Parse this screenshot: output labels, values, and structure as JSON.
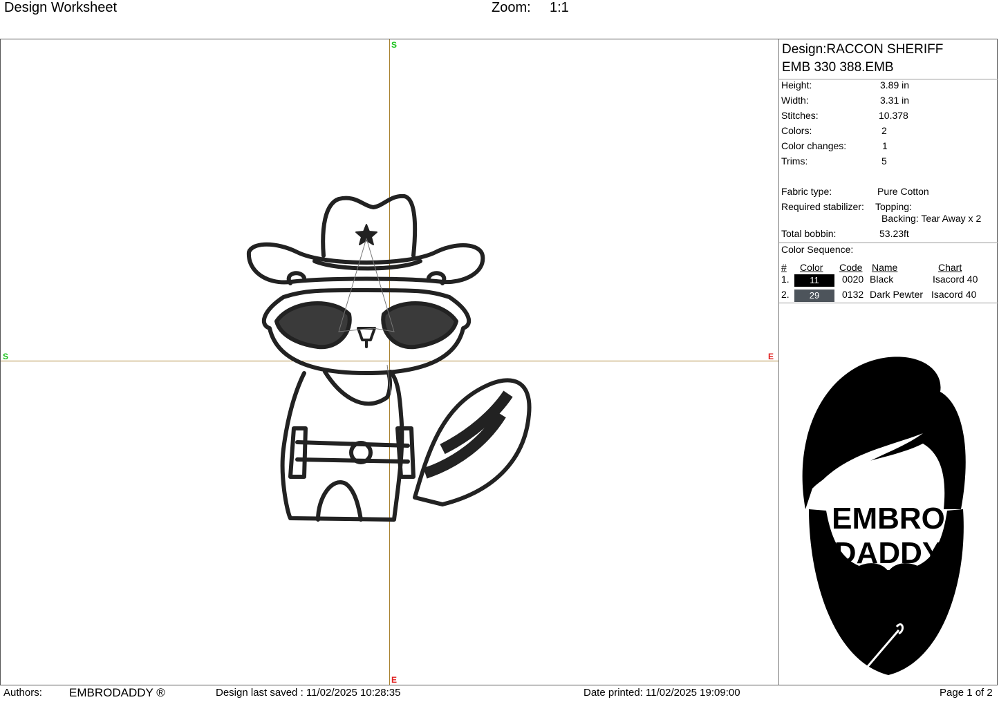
{
  "header": {
    "title": "Design Worksheet",
    "zoom_label": "Zoom:",
    "zoom_value": "1:1"
  },
  "canvas": {
    "axis_markers": {
      "start": "S",
      "end": "E"
    },
    "axis_color": "#a9822f",
    "start_color": "#18c21a",
    "end_color": "#e01d1d"
  },
  "design": {
    "name_line": "Design:RACCON SHERIFF",
    "file_line": "EMB 330 388.EMB"
  },
  "specs": [
    {
      "label": "Height:",
      "value": "3.89 in"
    },
    {
      "label": "Width:",
      "value": "3.31 in"
    },
    {
      "label": "Stitches:",
      "value": "10.378"
    },
    {
      "label": "Colors:",
      "value": "2"
    },
    {
      "label": "Color changes:",
      "value": "1"
    },
    {
      "label": "Trims:",
      "value": "5"
    }
  ],
  "materials": {
    "fabric_label": "Fabric type:",
    "fabric_value": "Pure Cotton",
    "stabilizer_label": "Required stabilizer:",
    "topping": "Topping:",
    "backing": "Backing: Tear Away x 2",
    "bobbin_label": "Total bobbin:",
    "bobbin_value": "53.23ft"
  },
  "color_sequence": {
    "title": "Color Sequence:",
    "headers": {
      "num": "#",
      "color": "Color",
      "code": "Code",
      "name": "Name",
      "chart": "Chart"
    },
    "rows": [
      {
        "num": "1.",
        "swatch": "11",
        "swatch_color": "#000000",
        "code": "0020",
        "name": "Black",
        "chart": "Isacord 40"
      },
      {
        "num": "2.",
        "swatch": "29",
        "swatch_color": "#4d545b",
        "code": "0132",
        "name": "Dark Pewter",
        "chart": "Isacord 40"
      }
    ]
  },
  "logo": {
    "line1": "EMBRO",
    "line2": "DADDY"
  },
  "footer": {
    "authors_label": "Authors:",
    "authors_value": "EMBRODADDY ®",
    "saved": "Design last saved : 11/02/2025 10:28:35",
    "printed": "Date printed: 11/02/2025 19:09:00",
    "page": "Page 1 of 2"
  }
}
